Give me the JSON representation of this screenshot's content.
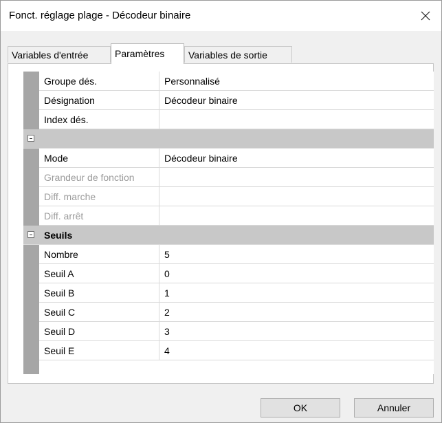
{
  "window": {
    "title": "Fonct. réglage plage - Décodeur binaire"
  },
  "tabs": [
    {
      "label": "Variables d'entrée"
    },
    {
      "label": "Paramètres"
    },
    {
      "label": "Variables de sortie"
    }
  ],
  "rows_general": [
    {
      "name": "Groupe dés.",
      "value": "Personnalisé"
    },
    {
      "name": "Désignation",
      "value": "Décodeur binaire"
    },
    {
      "name": "Index dés.",
      "value": ""
    }
  ],
  "section_params": {
    "label": ""
  },
  "rows_params": [
    {
      "name": "Mode",
      "value": "Décodeur binaire"
    },
    {
      "name": "Grandeur de fonction",
      "value": ""
    },
    {
      "name": "Diff. marche",
      "value": ""
    },
    {
      "name": "Diff. arrêt",
      "value": ""
    }
  ],
  "section_seuils": {
    "label": "Seuils"
  },
  "rows_seuils": [
    {
      "name": "Nombre",
      "value": "5"
    },
    {
      "name": "Seuil A",
      "value": "0"
    },
    {
      "name": "Seuil B",
      "value": "1"
    },
    {
      "name": "Seuil C",
      "value": "2"
    },
    {
      "name": "Seuil D",
      "value": "3"
    },
    {
      "name": "Seuil E",
      "value": "4"
    }
  ],
  "buttons": {
    "ok": "OK",
    "cancel": "Annuler"
  },
  "icons": {
    "close": "close-icon",
    "collapse": "collapse-minus-icon"
  }
}
